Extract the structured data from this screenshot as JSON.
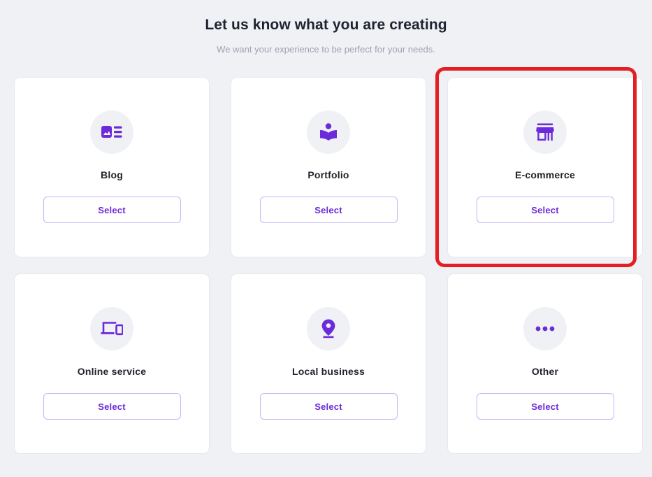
{
  "header": {
    "title": "Let us know what you are creating",
    "subtitle": "We want your experience to be perfect for your needs."
  },
  "colors": {
    "accent_purple": "#6c2bd9",
    "button_border": "#c3b6f5",
    "page_background": "#f0f1f5",
    "card_background": "#ffffff",
    "card_border": "#e6e8ee",
    "title_text": "#1f2330",
    "subtitle_text": "#9ea3b0",
    "highlight_red": "#e41f23"
  },
  "cards": [
    {
      "label": "Blog",
      "icon": "article-image-icon",
      "select_label": "Select",
      "highlighted": false
    },
    {
      "label": "Portfolio",
      "icon": "open-book-person-icon",
      "select_label": "Select",
      "highlighted": false
    },
    {
      "label": "E-commerce",
      "icon": "storefront-icon",
      "select_label": "Select",
      "highlighted": true
    },
    {
      "label": "Online service",
      "icon": "devices-laptop-phone-icon",
      "select_label": "Select",
      "highlighted": false
    },
    {
      "label": "Local business",
      "icon": "map-pin-icon",
      "select_label": "Select",
      "highlighted": false
    },
    {
      "label": "Other",
      "icon": "ellipsis-icon",
      "select_label": "Select",
      "highlighted": false
    }
  ],
  "annotation": {
    "type": "highlight-rectangle",
    "target": "E-commerce"
  }
}
